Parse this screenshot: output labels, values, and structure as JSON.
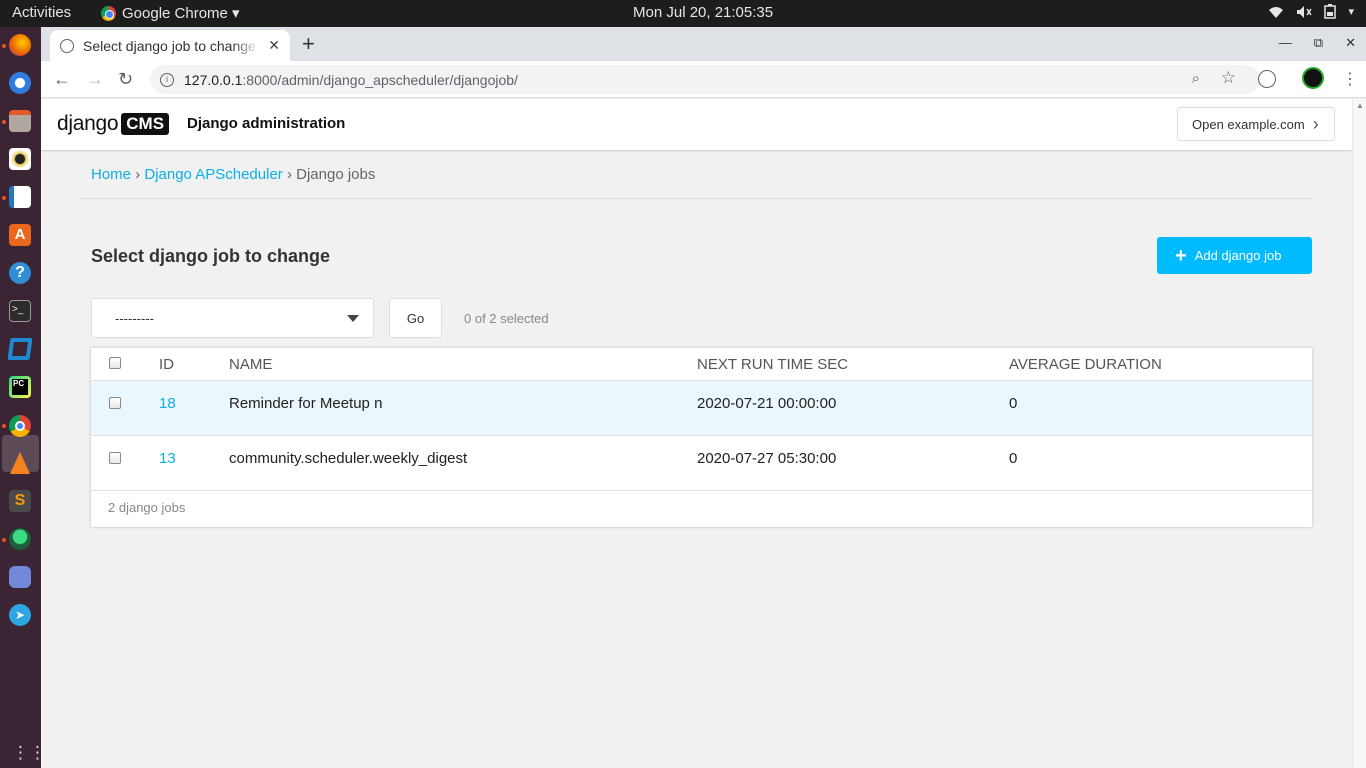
{
  "topbar": {
    "activities": "Activities",
    "app_name": "Google Chrome ▾",
    "clock": "Mon Jul 20, 21:05:35"
  },
  "dock": {
    "icons": [
      "firefox-icon",
      "thunderbird-icon",
      "files-icon",
      "rhythmbox-icon",
      "writer-icon",
      "software-icon",
      "help-icon",
      "terminal-icon",
      "vscode-icon",
      "pycharm-icon",
      "chrome-icon",
      "vlc-icon",
      "sublime-icon",
      "android-studio-icon",
      "discord-icon",
      "telegram-icon"
    ]
  },
  "browser": {
    "tab_title": "Select django job to change",
    "url_host": "127.0.0.1",
    "url_path": ":8000/admin/django_apscheduler/djangojob/"
  },
  "cms": {
    "logo_text": "django",
    "logo_badge": "CMS",
    "admin_title": "Django administration",
    "open_site": "Open example.com"
  },
  "breadcrumbs": {
    "home": "Home",
    "sep1": "›",
    "app": "Django APScheduler",
    "sep2": "›",
    "current": "Django jobs"
  },
  "content": {
    "title": "Select django job to change",
    "add_button": "Add django job",
    "action_placeholder": "---------",
    "go_button": "Go",
    "selected_count": "0 of 2 selected",
    "footer": "2 django jobs"
  },
  "table": {
    "headers": {
      "id": "ID",
      "name": "NAME",
      "next_run": "NEXT RUN TIME SEC",
      "avg": "AVERAGE DURATION"
    },
    "rows": [
      {
        "id": "18",
        "name": "Reminder for Meetup n",
        "next_run": "2020-07-21 00:00:00",
        "avg": "0"
      },
      {
        "id": "13",
        "name": "community.scheduler.weekly_digest",
        "next_run": "2020-07-27 05:30:00",
        "avg": "0"
      }
    ]
  },
  "colors": {
    "accent": "#00bbff",
    "link": "#0bb0e8",
    "dock_bg": "#3b2434",
    "topbar_bg": "#1d1d1d"
  }
}
